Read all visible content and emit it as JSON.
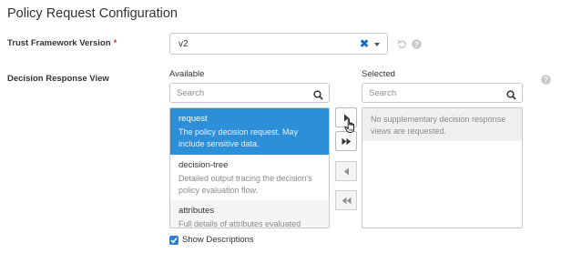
{
  "page": {
    "title": "Policy Request Configuration"
  },
  "trust_framework": {
    "label": "Trust Framework Version",
    "required_marker": "*",
    "value": "v2",
    "clear_icon": "x-icon",
    "accent_color": "#1b72c4"
  },
  "decision_response": {
    "label": "Decision Response View",
    "available": {
      "label": "Available",
      "search_placeholder": "Search",
      "items": [
        {
          "name": "request",
          "description": "The policy decision request. May include sensitive data.",
          "selected": true
        },
        {
          "name": "decision-tree",
          "description": "Detailed output tracing the decision's policy evaluation flow.",
          "selected": false
        },
        {
          "name": "attributes",
          "description": "Full details of attributes evaluated",
          "selected": false
        }
      ]
    },
    "selected": {
      "label": "Selected",
      "search_placeholder": "Search",
      "empty_message": "No supplementary decision response views are requested."
    },
    "buttons": {
      "move_right": "move-right-icon",
      "move_all_right": "move-all-right-icon",
      "move_left": "move-left-icon",
      "move_all_left": "move-all-left-icon"
    },
    "show_descriptions": {
      "label": "Show Descriptions",
      "checked": true
    }
  },
  "colors": {
    "selected_item_bg": "#2d8fd8",
    "required": "#c9302c",
    "checkbox": "#2d7fd0"
  }
}
